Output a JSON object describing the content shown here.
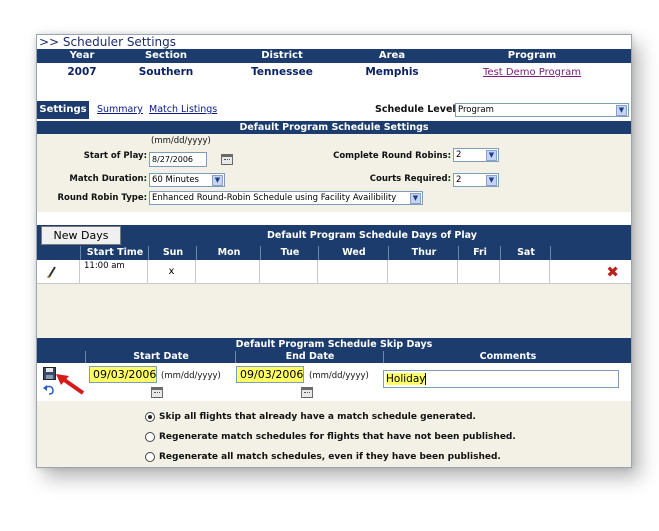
{
  "breadcrumb": ">> Scheduler Settings",
  "header": {
    "columns": [
      "Year",
      "Section",
      "District",
      "Area",
      "Program"
    ],
    "values": [
      "2007",
      "Southern",
      "Tennessee",
      "Memphis"
    ],
    "program_link": "Test Demo Program"
  },
  "tabs": {
    "active": "Settings",
    "links": [
      "Summary",
      "Match Listings"
    ],
    "schedule_level_label": "Schedule Level:",
    "schedule_level_value": "Program"
  },
  "settings": {
    "title": "Default Program Schedule Settings",
    "date_hint": "(mm/dd/yyyy)",
    "start_of_play_label": "Start of Play:",
    "start_of_play_value": "8/27/2006",
    "complete_rr_label": "Complete Round Robins:",
    "complete_rr_value": "2",
    "match_duration_label": "Match Duration:",
    "match_duration_value": "60 Minutes",
    "courts_required_label": "Courts Required:",
    "courts_required_value": "2",
    "rr_type_label": "Round Robin Type:",
    "rr_type_value": "Enhanced Round-Robin Schedule using Facility Availibility"
  },
  "days": {
    "new_button": "New Days",
    "title": "Default Program Schedule Days of Play",
    "columns": [
      "Start Time",
      "Sun",
      "Mon",
      "Tue",
      "Wed",
      "Thur",
      "Fri",
      "Sat"
    ],
    "row": {
      "start_time": "11:00 am",
      "sun": "x"
    }
  },
  "skip": {
    "title": "Default Program Schedule Skip Days",
    "columns": [
      "Start Date",
      "End Date",
      "Comments"
    ],
    "start_date": "09/03/2006",
    "end_date": "09/03/2006",
    "date_hint": "(mm/dd/yyyy)",
    "comment": "Holiday",
    "options": [
      "Skip all flights that already have a match schedule generated.",
      "Regenerate match schedules for flights that have not been published.",
      "Regenerate all match schedules, even if they have been published."
    ],
    "selected_option": 0
  },
  "colors": {
    "header_bg": "#1c3c6d",
    "panel_bg": "#f3f1e6",
    "highlight": "#ffff66",
    "delete": "#c0201a"
  }
}
